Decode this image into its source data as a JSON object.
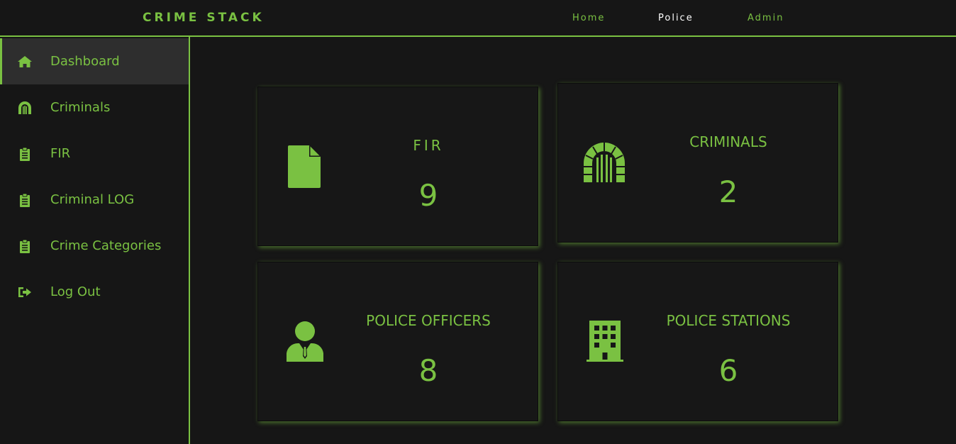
{
  "header": {
    "brand": "CRIME STACK",
    "nav": [
      {
        "label": "Home",
        "color": "#7ac142"
      },
      {
        "label": "Police",
        "color": "#ffffff"
      },
      {
        "label": "Admin",
        "color": "#7ac142"
      }
    ]
  },
  "sidebar": {
    "items": [
      {
        "label": "Dashboard",
        "icon": "home-icon",
        "active": true
      },
      {
        "label": "Criminals",
        "icon": "jail-icon"
      },
      {
        "label": "FIR",
        "icon": "clipboard-icon"
      },
      {
        "label": "Criminal LOG",
        "icon": "clipboard-icon"
      },
      {
        "label": "Crime Categories",
        "icon": "clipboard-icon"
      },
      {
        "label": "Log Out",
        "icon": "logout-icon"
      }
    ]
  },
  "cards": [
    {
      "title": "FIR",
      "value": "9",
      "icon": "file-icon"
    },
    {
      "title": "CRIMINALS",
      "value": "2",
      "icon": "jail-icon"
    },
    {
      "title": "POLICE OFFICERS",
      "value": "8",
      "icon": "officer-icon"
    },
    {
      "title": "POLICE STATIONS",
      "value": "6",
      "icon": "building-icon"
    }
  ],
  "colors": {
    "accent": "#7ac142",
    "background": "#161616",
    "active_nav": "#ffffff"
  }
}
